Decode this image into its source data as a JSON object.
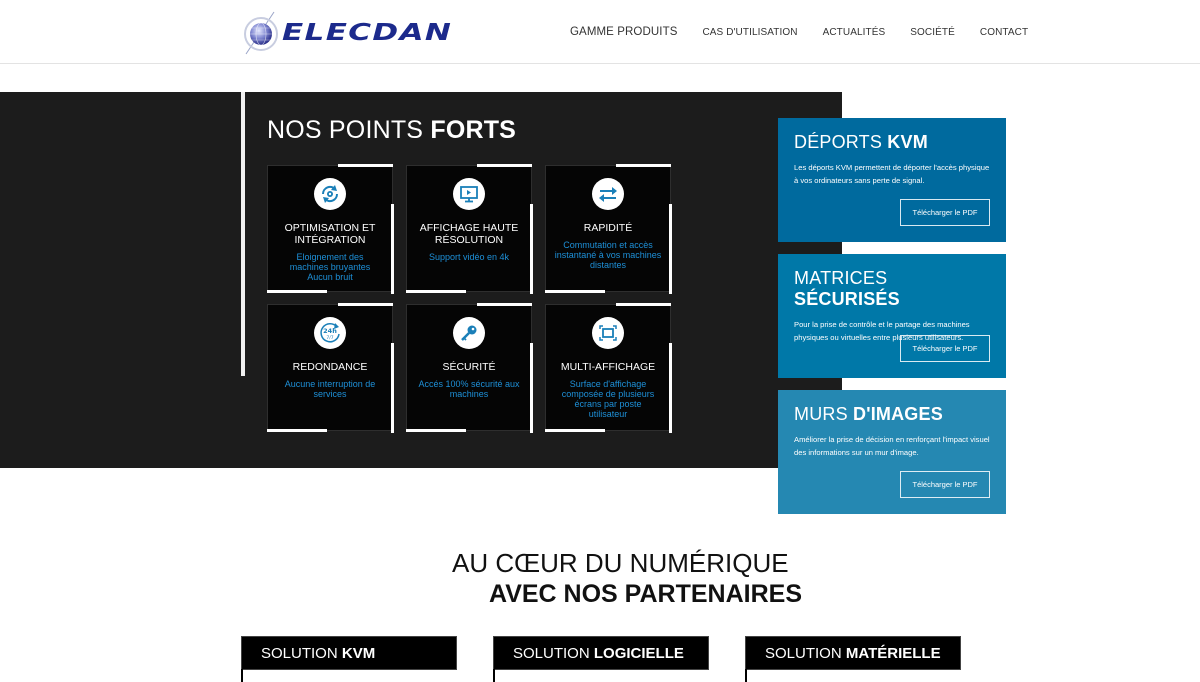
{
  "brand": {
    "name": "ELECDAN",
    "colors": {
      "logo_blue": "#1c2a8c",
      "accent_blue": "#1e90d8",
      "dark_bg": "#1c1c1c"
    }
  },
  "nav": {
    "items": [
      {
        "label": "GAMME PRODUITS"
      },
      {
        "label": "CAS D'UTILISATION"
      },
      {
        "label": "ACTUALITÉS"
      },
      {
        "label": "SOCIÉTÉ"
      },
      {
        "label": "CONTACT"
      }
    ]
  },
  "points": {
    "title_light": "NOS POINTS",
    "title_bold": "FORTS",
    "cards": [
      {
        "icon": "sync-gear-icon",
        "title": "OPTIMISATION ET INTÉGRATION",
        "desc_lines": [
          "Eloignement des machines bruyantes",
          "Aucun bruit"
        ]
      },
      {
        "icon": "monitor-play-icon",
        "title": "AFFICHAGE HAUTE RÉSOLUTION",
        "desc_lines": [
          "Support vidéo en 4k"
        ]
      },
      {
        "icon": "swap-arrows-icon",
        "title": "RAPIDITÉ",
        "desc_lines": [
          "Commutation et accès instantané à vos machines distantes"
        ]
      },
      {
        "icon": "24h-7-7-icon",
        "title": "REDONDANCE",
        "desc_lines": [
          "Aucune interruption de services"
        ]
      },
      {
        "icon": "key-icon",
        "title": "SÉCURITÉ",
        "desc_lines": [
          "Accés 100% sécurité aux machines"
        ]
      },
      {
        "icon": "screen-frame-icon",
        "title": "MULTI-AFFICHAGE",
        "desc_lines": [
          "Surface d'affichage composée de plusieurs écrans par poste utilisateur"
        ]
      }
    ]
  },
  "panels": [
    {
      "title_light": "DÉPORTS",
      "title_bold": "KVM",
      "desc": "Les déports KVM permettent de déporter l'accès physique à vos ordinateurs sans perte de signal.",
      "button": "Télécharger le PDF",
      "color": "#006a9e"
    },
    {
      "title_light": "MATRICES",
      "title_bold": "SÉCURISÉS",
      "desc": "Pour la prise de contrôle et le partage des machines physiques ou virtuelles entre plusieurs utilisateurs.",
      "button": "Télécharger le PDF",
      "color": "#0078a8"
    },
    {
      "title_light": "MURS",
      "title_bold": "D'IMAGES",
      "desc": "Améliorer la prise de décision en renforçant l'impact visuel des informations sur un mur d'image.",
      "button": "Télécharger le PDF",
      "color": "#2588b2"
    }
  ],
  "partners": {
    "line1": "AU CŒUR DU NUMÉRIQUE",
    "line2": "AVEC NOS PARTENAIRES",
    "solutions": [
      {
        "light": "SOLUTION",
        "bold": "KVM"
      },
      {
        "light": "SOLUTION",
        "bold": "LOGICIELLE"
      },
      {
        "light": "SOLUTION",
        "bold": "MATÉRIELLE"
      }
    ]
  }
}
